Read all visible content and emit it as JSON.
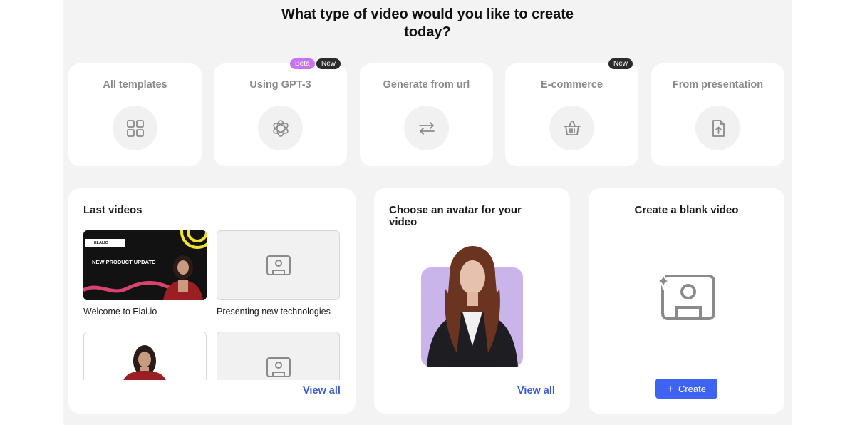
{
  "header": {
    "title_line1": "What type of video would you like to create",
    "title_line2": "today?"
  },
  "types": [
    {
      "label": "All templates",
      "icon": "grid-icon"
    },
    {
      "label": "Using GPT-3",
      "icon": "openai-icon"
    },
    {
      "label": "Generate from url",
      "icon": "swap-arrows-icon"
    },
    {
      "label": "E-commerce",
      "icon": "basket-icon"
    },
    {
      "label": "From presentation",
      "icon": "file-upload-icon"
    }
  ],
  "badges": {
    "beta": "Beta",
    "new": "New"
  },
  "last_videos": {
    "title": "Last videos",
    "items": [
      {
        "caption": "Welcome to Elai.io",
        "thumb_tag": "ELAI.IO",
        "thumb_headline": "NEW PRODUCT UPDATE"
      },
      {
        "caption": "Presenting new technologies"
      },
      {
        "caption": ""
      },
      {
        "caption": ""
      }
    ],
    "view_all": "View all"
  },
  "avatar": {
    "title": "Choose an avatar for your video",
    "view_all": "View all"
  },
  "blank": {
    "title": "Create a blank video",
    "button": "Create"
  },
  "colors": {
    "accent": "#3f63f1",
    "link": "#3b5bdb",
    "beta_badge": "#c874ee",
    "new_badge": "#2b2b2b",
    "background": "#f3f3f4"
  }
}
